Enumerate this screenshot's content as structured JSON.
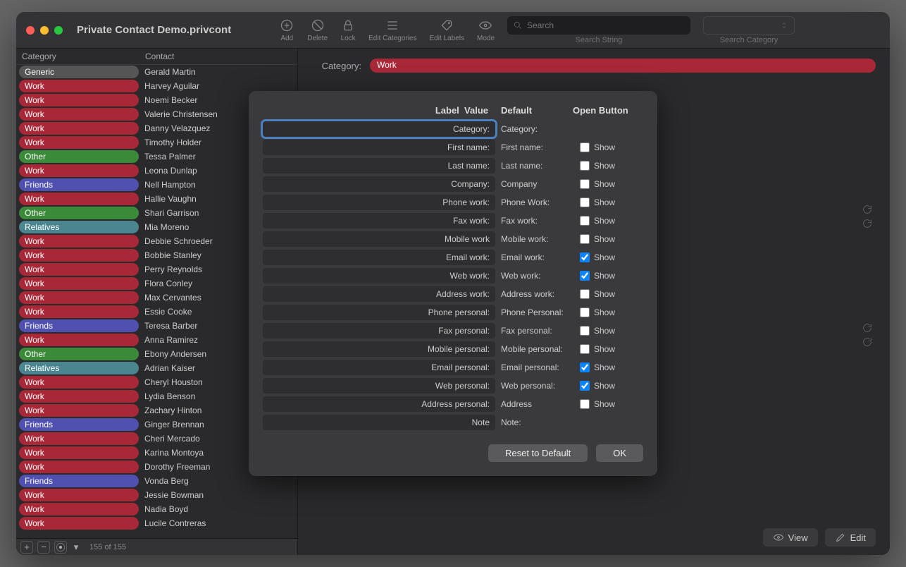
{
  "window": {
    "title": "Private Contact Demo.privcont"
  },
  "toolbar": {
    "add": "Add",
    "delete": "Delete",
    "lock": "Lock",
    "edit_categories": "Edit Categories",
    "edit_labels": "Edit Labels",
    "mode": "Mode",
    "search_placeholder": "Search",
    "search_string_label": "Search String",
    "search_category_label": "Search Category"
  },
  "sidebar": {
    "header_category": "Category",
    "header_contact": "Contact",
    "footer_count": "155 of 155",
    "contacts": [
      {
        "cat": "Generic",
        "name": "Gerald Martin"
      },
      {
        "cat": "Work",
        "name": "Harvey Aguilar"
      },
      {
        "cat": "Work",
        "name": "Noemi Becker"
      },
      {
        "cat": "Work",
        "name": "Valerie Christensen"
      },
      {
        "cat": "Work",
        "name": "Danny Velazquez"
      },
      {
        "cat": "Work",
        "name": "Timothy Holder"
      },
      {
        "cat": "Other",
        "name": "Tessa Palmer"
      },
      {
        "cat": "Work",
        "name": "Leona Dunlap"
      },
      {
        "cat": "Friends",
        "name": "Nell Hampton"
      },
      {
        "cat": "Work",
        "name": "Hallie Vaughn"
      },
      {
        "cat": "Other",
        "name": "Shari Garrison"
      },
      {
        "cat": "Relatives",
        "name": "Mia Moreno"
      },
      {
        "cat": "Work",
        "name": "Debbie Schroeder"
      },
      {
        "cat": "Work",
        "name": "Bobbie Stanley"
      },
      {
        "cat": "Work",
        "name": "Perry Reynolds"
      },
      {
        "cat": "Work",
        "name": "Flora Conley"
      },
      {
        "cat": "Work",
        "name": "Max Cervantes"
      },
      {
        "cat": "Work",
        "name": "Essie Cooke"
      },
      {
        "cat": "Friends",
        "name": "Teresa Barber"
      },
      {
        "cat": "Work",
        "name": "Anna Ramirez"
      },
      {
        "cat": "Other",
        "name": "Ebony Andersen"
      },
      {
        "cat": "Relatives",
        "name": "Adrian Kaiser"
      },
      {
        "cat": "Work",
        "name": "Cheryl Houston"
      },
      {
        "cat": "Work",
        "name": "Lydia Benson"
      },
      {
        "cat": "Work",
        "name": "Zachary Hinton"
      },
      {
        "cat": "Friends",
        "name": "Ginger Brennan"
      },
      {
        "cat": "Work",
        "name": "Cheri Mercado"
      },
      {
        "cat": "Work",
        "name": "Karina Montoya"
      },
      {
        "cat": "Work",
        "name": "Dorothy Freeman"
      },
      {
        "cat": "Friends",
        "name": "Vonda Berg"
      },
      {
        "cat": "Work",
        "name": "Jessie Bowman"
      },
      {
        "cat": "Work",
        "name": "Nadia Boyd"
      },
      {
        "cat": "Work",
        "name": "Lucile Contreras"
      }
    ]
  },
  "main": {
    "category_label": "Category:",
    "category_value": "Work",
    "view_btn": "View",
    "edit_btn": "Edit"
  },
  "modal": {
    "header": {
      "label": "Label",
      "value": "Value",
      "default": "Default",
      "open": "Open Button"
    },
    "show_label": "Show",
    "rows": [
      {
        "label": "Category:",
        "default": "Category:",
        "checkbox": null,
        "selected": true
      },
      {
        "label": "First name:",
        "default": "First name:",
        "checkbox": false
      },
      {
        "label": "Last name:",
        "default": "Last name:",
        "checkbox": false
      },
      {
        "label": "Company:",
        "default": "Company",
        "checkbox": false
      },
      {
        "label": "Phone work:",
        "default": "Phone Work:",
        "checkbox": false
      },
      {
        "label": "Fax work:",
        "default": "Fax work:",
        "checkbox": false
      },
      {
        "label": "Mobile work",
        "default": "Mobile work:",
        "checkbox": false
      },
      {
        "label": "Email work:",
        "default": "Email work:",
        "checkbox": true
      },
      {
        "label": "Web work:",
        "default": "Web work:",
        "checkbox": true
      },
      {
        "label": "Address work:",
        "default": "Address work:",
        "checkbox": false
      },
      {
        "label": "Phone personal:",
        "default": "Phone Personal:",
        "checkbox": false
      },
      {
        "label": "Fax personal:",
        "default": "Fax personal:",
        "checkbox": false
      },
      {
        "label": "Mobile personal:",
        "default": "Mobile personal:",
        "checkbox": false
      },
      {
        "label": "Email personal:",
        "default": "Email personal:",
        "checkbox": true
      },
      {
        "label": "Web personal:",
        "default": "Web personal:",
        "checkbox": true
      },
      {
        "label": "Address personal:",
        "default": "Address",
        "checkbox": false
      },
      {
        "label": "Note",
        "default": "Note:",
        "checkbox": null
      }
    ],
    "reset_btn": "Reset to Default",
    "ok_btn": "OK"
  }
}
